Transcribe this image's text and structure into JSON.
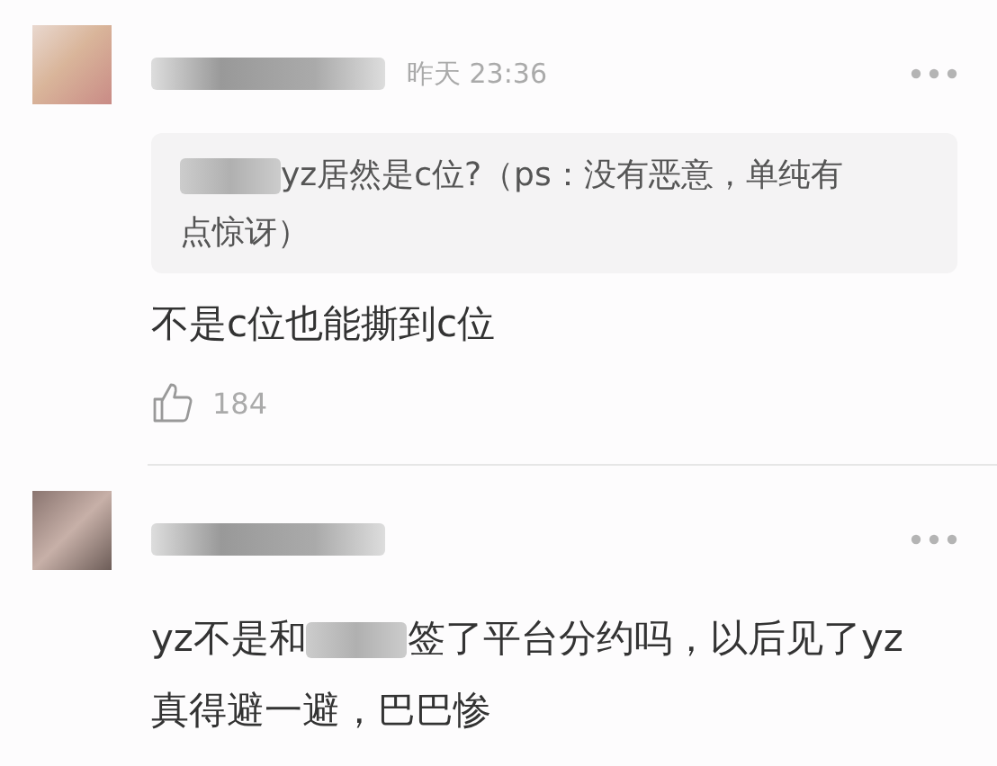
{
  "comments": [
    {
      "time": "昨天 23:36",
      "quote": [
        {
          "kind": "redacted"
        },
        {
          "kind": "text",
          "text": "yz居然是c位?（ps：没有恶意，单纯有"
        },
        {
          "kind": "break"
        },
        {
          "kind": "text",
          "text": "点惊讶）"
        }
      ],
      "body": [
        {
          "kind": "text",
          "text": "不是c位也能撕到c位"
        }
      ],
      "likes": "184"
    },
    {
      "body": [
        {
          "kind": "text",
          "text": "yz不是和"
        },
        {
          "kind": "redacted"
        },
        {
          "kind": "text",
          "text": "签了平台分约吗，以后见了yz"
        },
        {
          "kind": "break"
        },
        {
          "kind": "text",
          "text": "真得避一避，巴巴惨"
        }
      ]
    }
  ]
}
